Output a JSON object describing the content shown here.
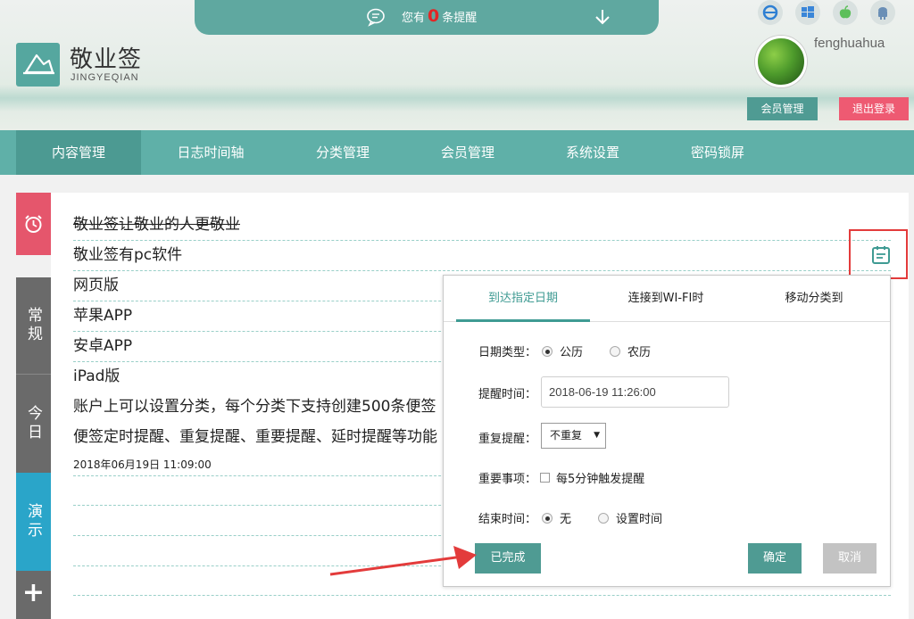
{
  "notice": {
    "prefix": "您有",
    "count": "0",
    "suffix": "条提醒"
  },
  "brand": {
    "title": "敬业签",
    "subtitle": "JINGYEQIAN"
  },
  "os_icons": [
    "ie-icon",
    "windows-icon",
    "apple-icon",
    "android-icon"
  ],
  "user": {
    "name": "fenghuahua",
    "member_btn": "会员管理",
    "logout_btn": "退出登录"
  },
  "nav": [
    "内容管理",
    "日志时间轴",
    "分类管理",
    "会员管理",
    "系统设置",
    "密码锁屏"
  ],
  "sidebar": {
    "tabs": [
      "常规",
      "今日",
      "演示"
    ],
    "add": "+"
  },
  "notes": [
    "敬业签让敬业的人更敬业",
    "敬业签有pc软件",
    "网页版",
    "苹果APP",
    "安卓APP",
    "iPad版",
    "账户上可以设置分类，每个分类下支持创建500条便签",
    "便签定时提醒、重复提醒、重要提醒、延时提醒等功能"
  ],
  "note_date": "2018年06月19日 11:09:00",
  "popup": {
    "tabs": [
      "到达指定日期",
      "连接到WI-FI时",
      "移动分类到"
    ],
    "date_type_label": "日期类型：",
    "date_type_options": [
      "公历",
      "农历"
    ],
    "remind_time_label": "提醒时间：",
    "remind_time_value": "2018-06-19 11:26:00",
    "repeat_label": "重复提醒：",
    "repeat_value": "不重复",
    "important_label": "重要事项：",
    "important_option": "每5分钟触发提醒",
    "end_time_label": "结束时间：",
    "end_time_options": [
      "无",
      "设置时间"
    ],
    "done_btn": "已完成",
    "ok_btn": "确定",
    "cancel_btn": "取消"
  },
  "colors": {
    "teal": "#5fb0a8",
    "teal_dark": "#4f9b93",
    "pink": "#ee5a72",
    "blue_tab": "#2aa5c9",
    "highlight_red": "#e33b3b"
  }
}
